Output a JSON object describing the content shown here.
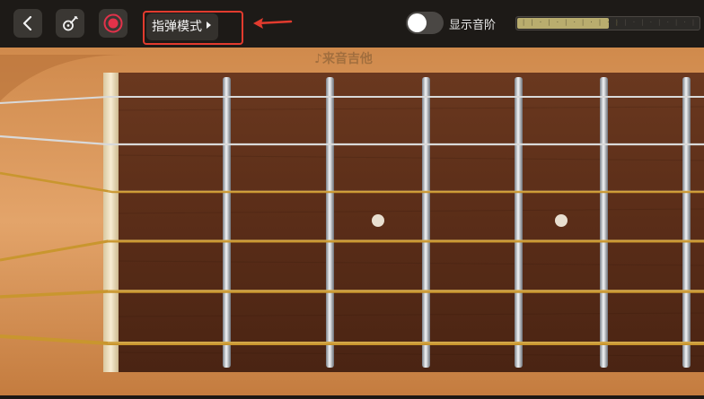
{
  "toolbar": {
    "back_icon": "chevron-left-icon",
    "guitar_icon": "guitar-icon",
    "record_icon": "record-icon",
    "mode_label": "指弹模式"
  },
  "display_toggle": {
    "label": "显示音阶",
    "on": false
  },
  "brand": {
    "text": "来音吉他",
    "icon": "music-note-icon"
  },
  "colors": {
    "highlight": "#e23b2e",
    "toolbar_bg": "#1d1a17",
    "fretboard": "#5a2f1a",
    "nut": "#f1e3c2",
    "string_gold": "#c9962e",
    "string_silver": "#d9d9d9"
  },
  "fretboard": {
    "string_count": 6,
    "visible_fret_count": 6,
    "inlay_markers": [
      "fret-3",
      "fret-5"
    ]
  }
}
